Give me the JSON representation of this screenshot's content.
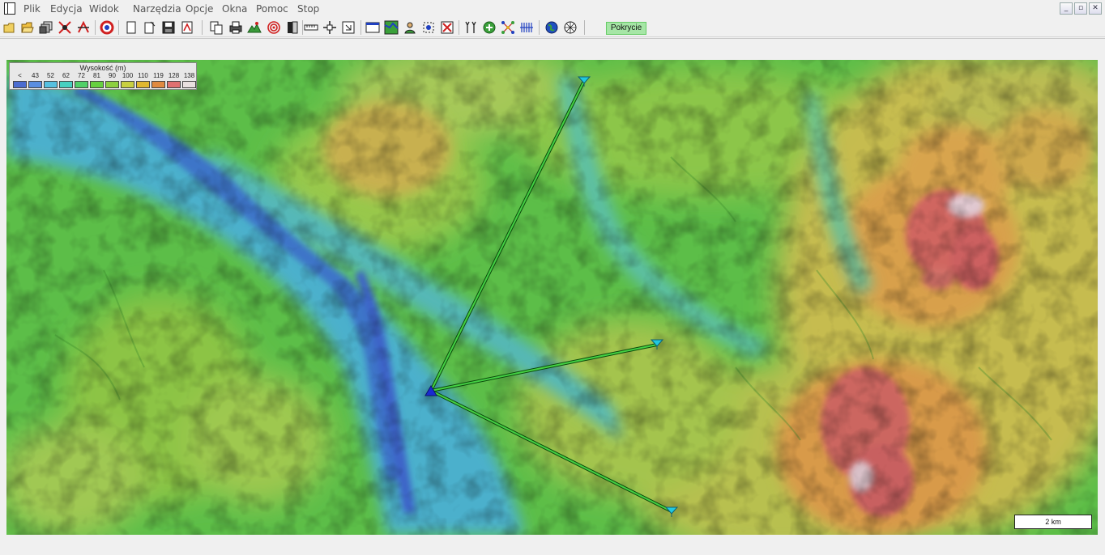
{
  "menu": {
    "items": [
      "Plik",
      "Edycja",
      "Widok",
      "Narzędzia",
      "Opcje",
      "Okna",
      "Pomoc",
      "Stop"
    ]
  },
  "toolbar": {
    "coverage_label": "Pokrycie"
  },
  "legend": {
    "title": "Wysokość (m)",
    "labels": [
      "<",
      "43",
      "52",
      "62",
      "72",
      "81",
      "90",
      "100",
      "110",
      "119",
      "128",
      "138"
    ],
    "colors": [
      "#4a6cd0",
      "#5a8ee0",
      "#56c0e0",
      "#46d0c0",
      "#50d068",
      "#66d040",
      "#8cd040",
      "#c8d040",
      "#e0b830",
      "#e08a40",
      "#e07070",
      "#e8e0e0"
    ]
  },
  "map": {
    "scale_label": "2 km"
  },
  "colors": {
    "link": "#2aa82a",
    "transmitter": "#1a2ad0",
    "receiver": "#20c8e0"
  }
}
